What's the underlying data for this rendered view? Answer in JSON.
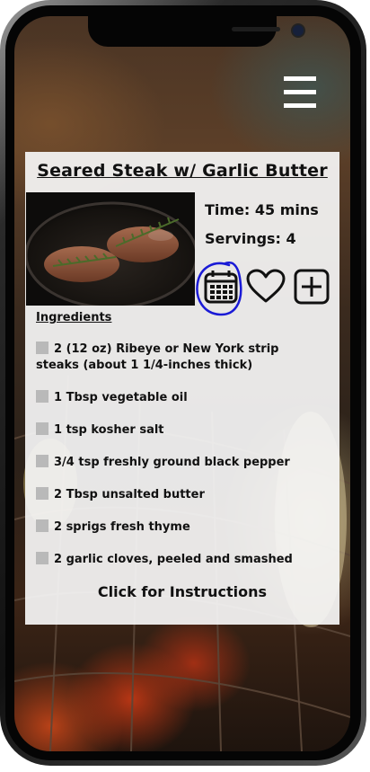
{
  "recipe": {
    "title": "Seared Steak w/ Garlic Butter",
    "time": "Time: 45 mins",
    "servings": "Servings: 4",
    "ingredients_heading": "Ingredients",
    "ingredients": [
      "2 (12 oz) Ribeye or New York strip steaks (about 1 1/4-inches thick)",
      "1 Tbsp vegetable oil",
      "1 tsp kosher salt",
      "3/4 tsp freshly ground black pepper",
      "2 Tbsp unsalted butter",
      "2 sprigs fresh thyme",
      "2 garlic cloves, peeled and smashed"
    ],
    "instructions_link": "Click for Instructions"
  },
  "icons": {
    "menu": "hamburger-menu-icon",
    "calendar": "calendar-icon",
    "favorite": "heart-icon",
    "add": "plus-square-icon"
  },
  "colors": {
    "card_background": "#f7f7f7",
    "calendar_highlight": "#1a1ad6",
    "checkbox": "#b9b9b9",
    "text": "#111111"
  }
}
